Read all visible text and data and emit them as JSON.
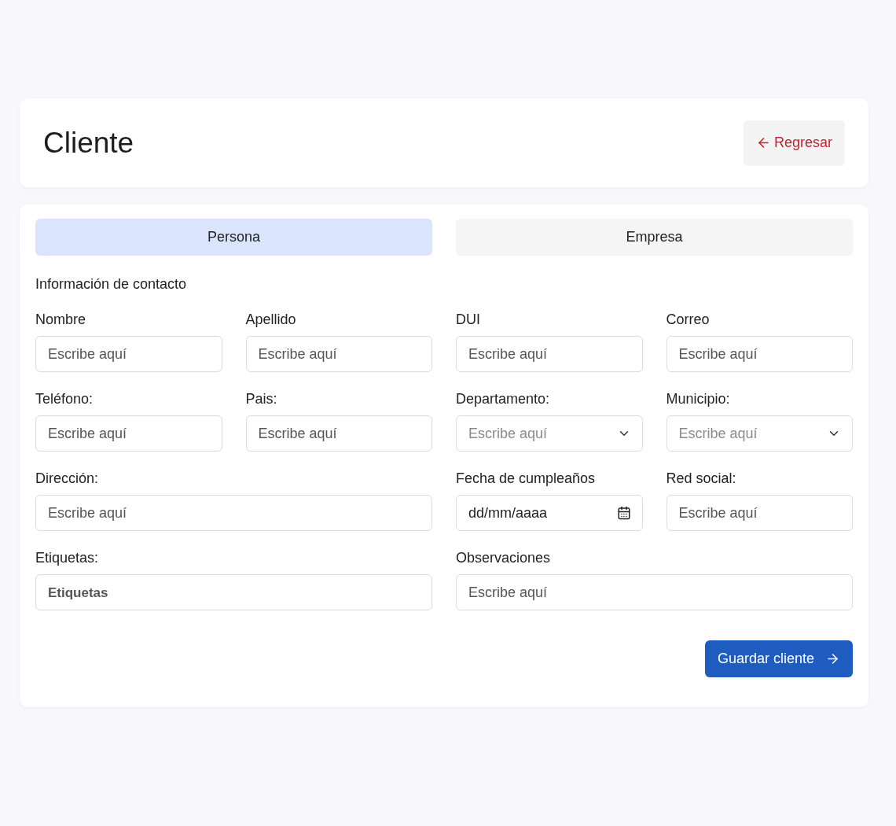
{
  "header": {
    "title": "Cliente",
    "back_button": {
      "label": "Regresar"
    }
  },
  "tabs": [
    {
      "label": "Persona",
      "selected": true
    },
    {
      "label": "Empresa",
      "selected": false
    }
  ],
  "section_title": "Información de contacto",
  "rows": [
    {
      "left": [
        {
          "label": "Nombre",
          "kind": "text",
          "placeholder": "Escribe aquí"
        },
        {
          "label": "Apellido",
          "kind": "text",
          "placeholder": "Escribe aquí"
        }
      ],
      "right": [
        {
          "label": "DUI",
          "kind": "text",
          "placeholder": "Escribe aquí"
        },
        {
          "label": "Correo",
          "kind": "text",
          "placeholder": "Escribe aquí"
        }
      ]
    },
    {
      "left": [
        {
          "label": "Teléfono:",
          "kind": "text",
          "placeholder": "Escribe aquí"
        },
        {
          "label": "Pais:",
          "kind": "text",
          "placeholder": "Escribe aquí"
        }
      ],
      "right": [
        {
          "label": "Departamento:",
          "kind": "select",
          "placeholder": "Escribe aquí"
        },
        {
          "label": "Municipio:",
          "kind": "select",
          "placeholder": "Escribe aquí"
        }
      ]
    },
    {
      "left": [
        {
          "label": "Dirección:",
          "kind": "text",
          "placeholder": "Escribe aquí"
        }
      ],
      "right": [
        {
          "label": "Fecha de cumpleaños",
          "kind": "date",
          "placeholder": "dd/mm/aaaa"
        },
        {
          "label": "Red social:",
          "kind": "text",
          "placeholder": "Escribe aquí"
        }
      ]
    },
    {
      "left": [
        {
          "label": "Etiquetas:",
          "kind": "tags",
          "placeholder": "Etiquetas"
        }
      ],
      "right": [
        {
          "label": "Observaciones",
          "kind": "text",
          "placeholder": "Escribe aquí"
        }
      ]
    }
  ],
  "submit_button": {
    "label": "Guardar cliente"
  }
}
